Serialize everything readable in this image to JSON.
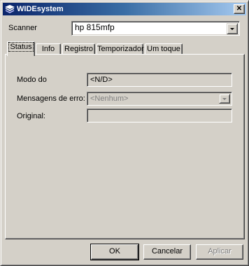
{
  "window": {
    "title": "WIDEsystem",
    "close_glyph": "✕"
  },
  "scanner": {
    "label": "Scanner",
    "value": "hp 815mfp"
  },
  "tabs": [
    {
      "label": "Status",
      "active": true
    },
    {
      "label": "Info",
      "active": false
    },
    {
      "label": "Registro",
      "active": false
    },
    {
      "label": "Temporizador",
      "active": false
    },
    {
      "label": "Um toque",
      "active": false
    }
  ],
  "status_panel": {
    "mode_label": "Modo do",
    "mode_value": "<N/D>",
    "errors_label": "Mensagens de erro:",
    "errors_value": "<Nenhum>",
    "original_label": "Original:",
    "original_value": ""
  },
  "buttons": {
    "ok": "OK",
    "cancel": "Cancelar",
    "apply": "Aplicar"
  },
  "icons": [
    "app-logo-icon",
    "close-icon",
    "chevron-down-icon"
  ],
  "colors": {
    "face": "#d4d0c8",
    "title_start": "#0a246a",
    "title_end": "#a6caf0",
    "disabled_text": "#808080"
  }
}
